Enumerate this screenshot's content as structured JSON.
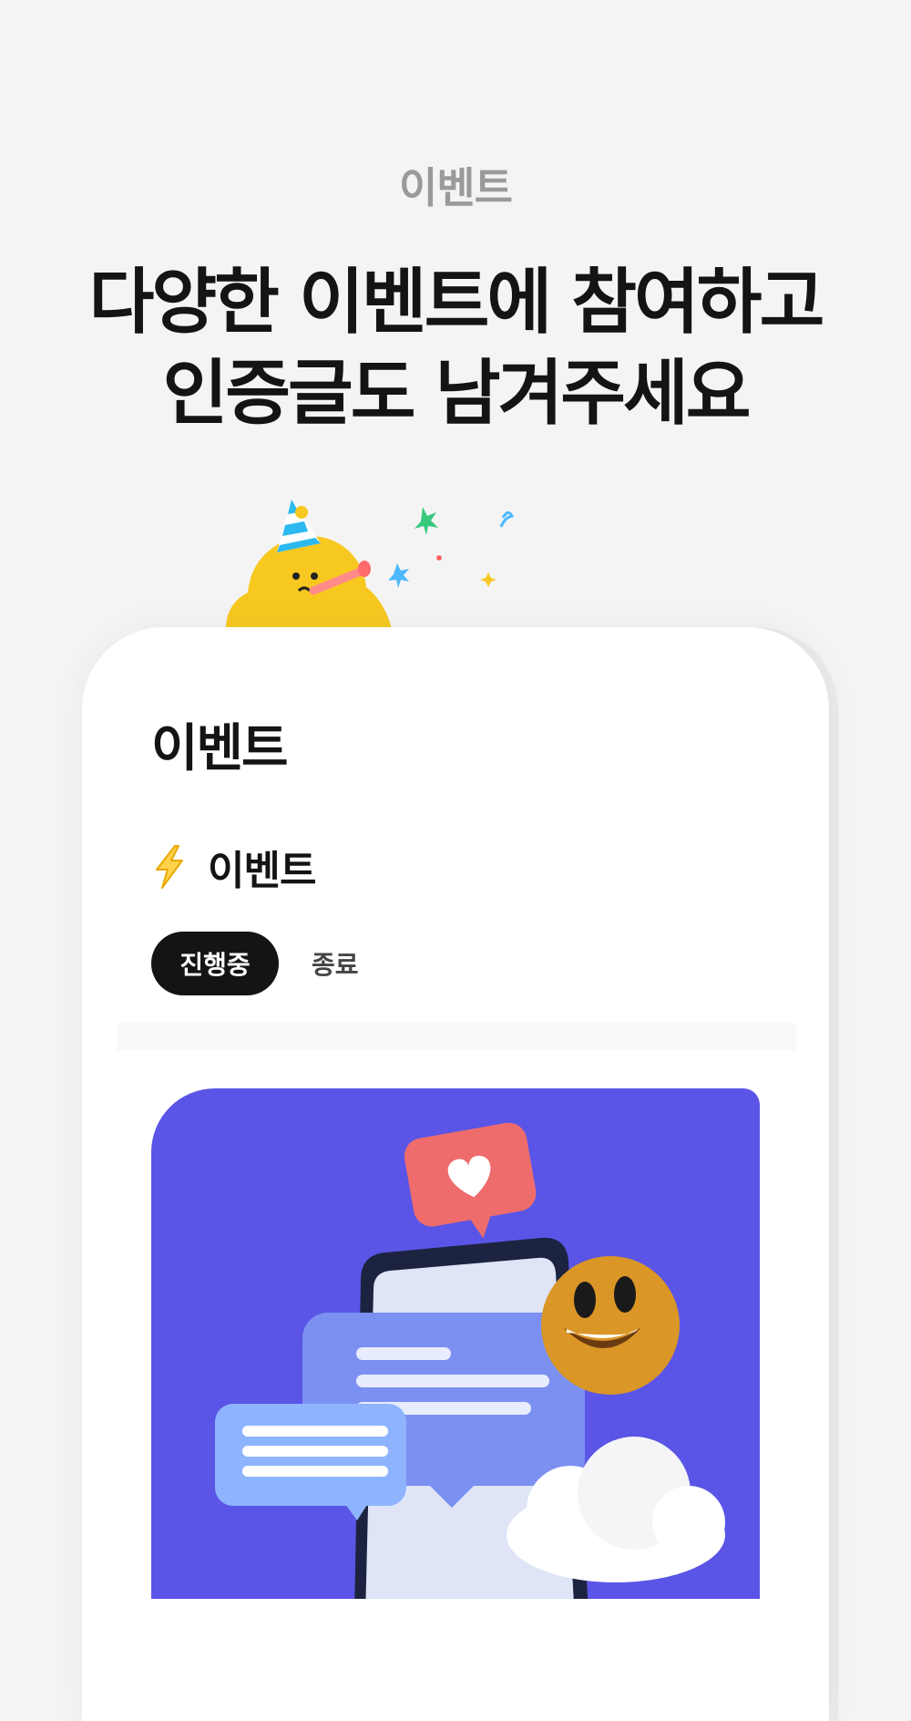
{
  "promo": {
    "eyebrow": "이벤트",
    "headline_line1": "다양한 이벤트에 참여하고",
    "headline_line2": "인증글도 남겨주세요"
  },
  "app": {
    "page_title": "이벤트",
    "section": {
      "icon": "lightning-icon",
      "title": "이벤트"
    },
    "tabs": [
      {
        "label": "진행중",
        "active": true
      },
      {
        "label": "종료",
        "active": false
      }
    ],
    "banner": {
      "background": "#5a55e6",
      "illustration": "phone-chat-heart-emoji-cloud-illustration"
    }
  },
  "colors": {
    "background": "#f4f4f4",
    "text_primary": "#141414",
    "text_muted": "#9a9a9a",
    "accent_yellow": "#f7c820"
  }
}
